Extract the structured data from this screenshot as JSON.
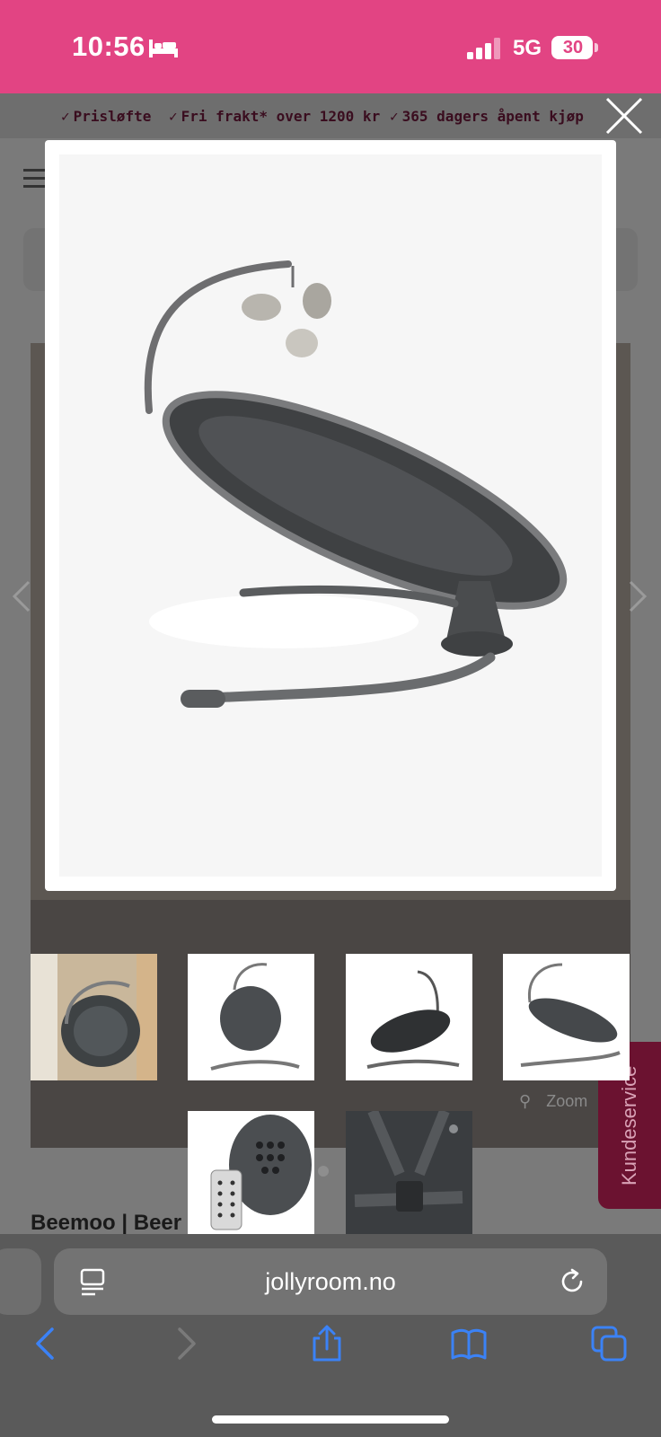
{
  "status_bar": {
    "time": "10:56",
    "network": "5G",
    "battery": "30",
    "background_color": "#e24483"
  },
  "usp_bar": {
    "items": [
      "Prisløfte",
      "Fri frakt* over 1200 kr",
      "365 dagers åpent kjøp"
    ],
    "check_glyph": "✓"
  },
  "product": {
    "title_partial": "Beemoo | Beer",
    "zoom_label": "Zoom"
  },
  "support_tab": {
    "label": "Kundeservice"
  },
  "modal": {
    "image_icon": "baby-bouncer-product-image"
  },
  "thumbnails": [
    {
      "icon": "bouncer-lifestyle-thumb"
    },
    {
      "icon": "bouncer-front-thumb"
    },
    {
      "icon": "bouncer-angle-thumb"
    },
    {
      "icon": "bouncer-side-thumb"
    },
    {
      "icon": "remote-control-thumb"
    },
    {
      "icon": "harness-closeup-thumb"
    }
  ],
  "browser": {
    "url": "jollyroom.no"
  }
}
